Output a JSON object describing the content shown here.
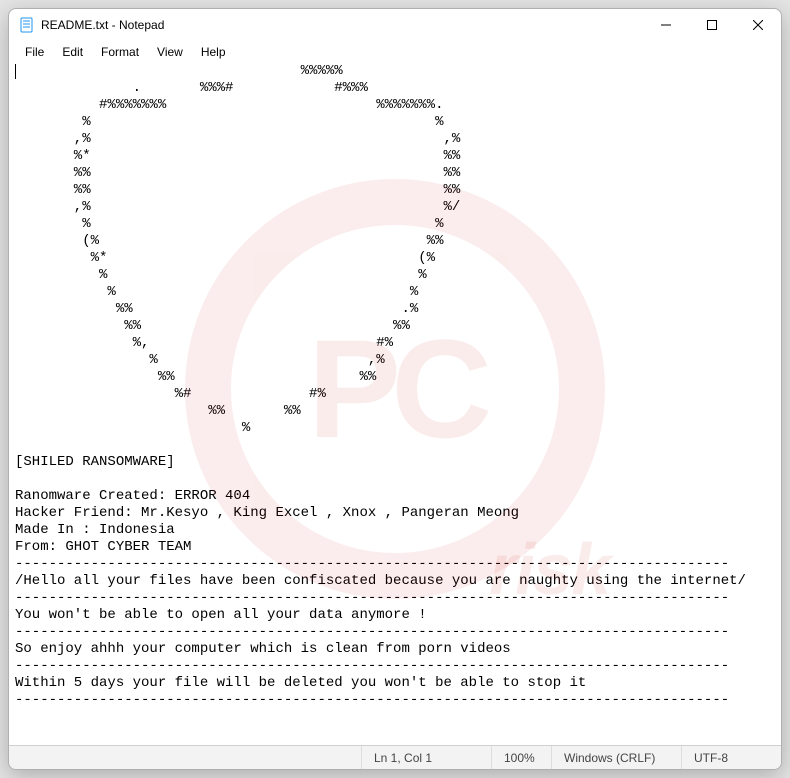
{
  "titlebar": {
    "title": "README.txt - Notepad"
  },
  "menu": {
    "file": "File",
    "edit": "Edit",
    "format": "Format",
    "view": "View",
    "help": "Help"
  },
  "document_text": "                                  %%%%%\n              .       %%%#            #%%%\n          #%%%%%%%                         %%%%%%%.\n        %                                         %\n       ,%                                          ,%\n       %*                                          %%\n       %%                                          %%\n       %%                                          %%\n       ,%                                          %/\n        %                                         %\n        (%                                       %%\n         %*                                     (%\n          %                                     %\n           %                                   %\n            %%                                .%\n             %%                              %%\n              %,                           #%\n                %                         ,%\n                 %%                      %%\n                   %#              #%\n                       %%       %%\n                           %\n\n[SHILED RANSOMWARE]\n\nRanomware Created: ERROR 404\nHacker Friend: Mr.Kesyo , King Excel , Xnox , Pangeran Meong\nMade In : Indonesia\nFrom: GHOT CYBER TEAM\n-------------------------------------------------------------------------------------\n/Hello all your files have been confiscated because you are naughty using the internet/\n-------------------------------------------------------------------------------------\nYou won't be able to open all your data anymore !\n-------------------------------------------------------------------------------------\nSo enjoy ahhh your computer which is clean from porn videos\n-------------------------------------------------------------------------------------\nWithin 5 days your file will be deleted you won't be able to stop it\n-------------------------------------------------------------------------------------",
  "status": {
    "position": "Ln 1, Col 1",
    "zoom": "100%",
    "line_ending": "Windows (CRLF)",
    "encoding": "UTF-8"
  },
  "watermark": {
    "pc": "PC",
    "risk": "risk"
  }
}
